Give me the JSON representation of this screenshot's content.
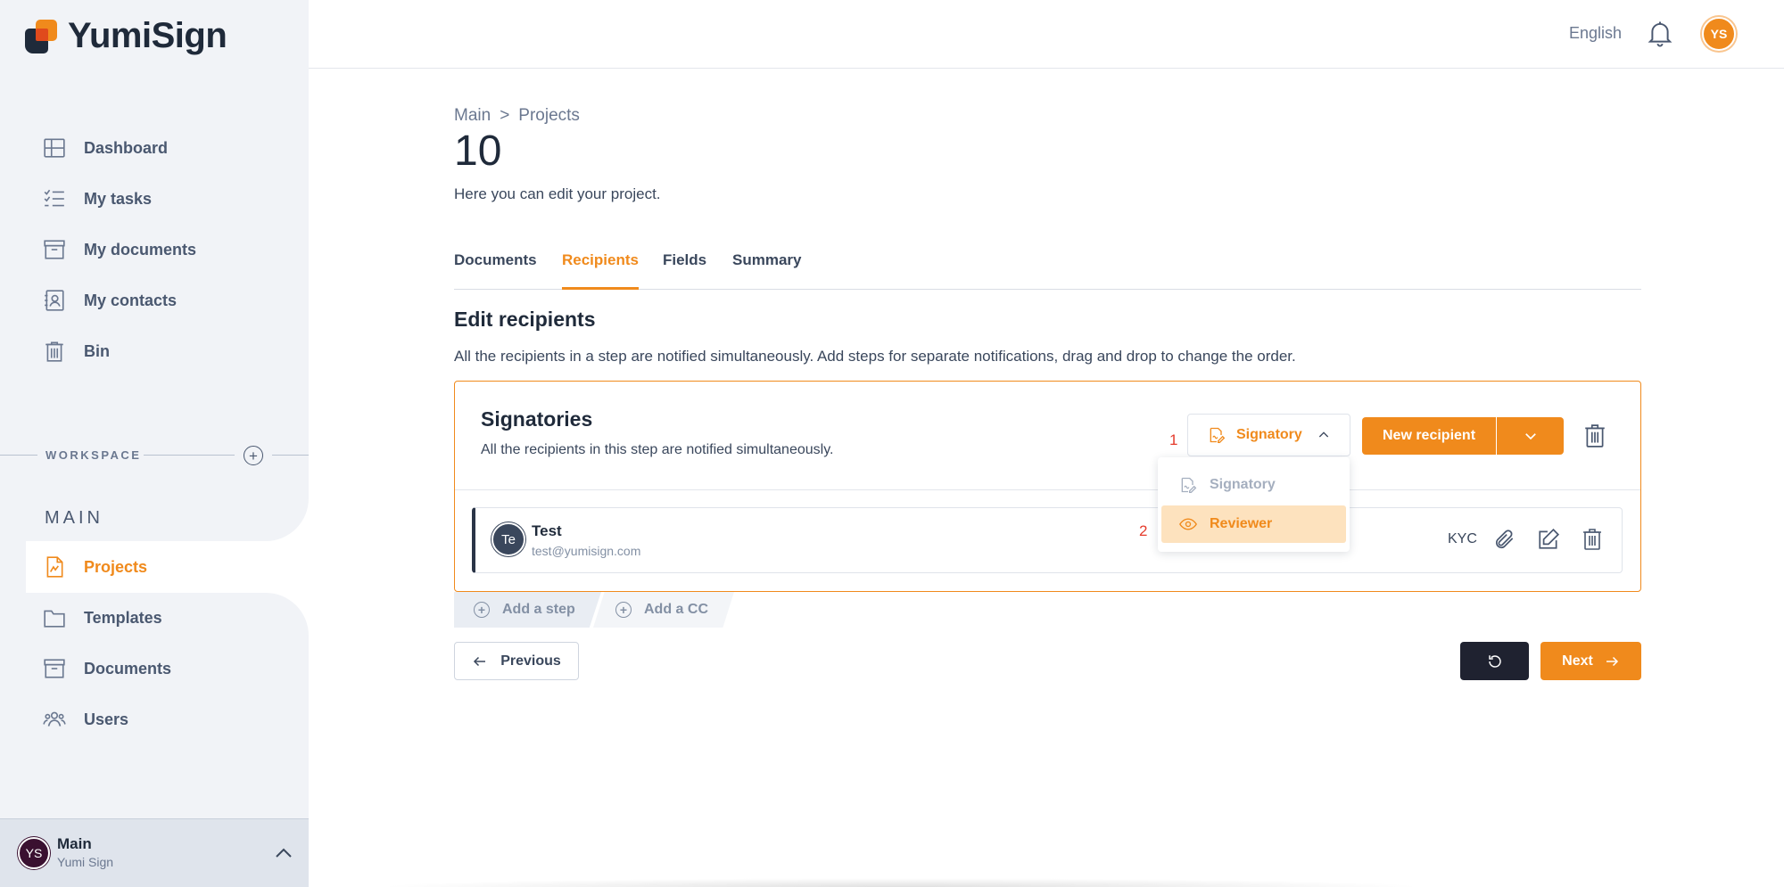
{
  "app": {
    "name": "YumiSign"
  },
  "sidebar": {
    "nav": [
      {
        "label": "Dashboard",
        "icon": "dashboard-icon"
      },
      {
        "label": "My tasks",
        "icon": "tasks-icon"
      },
      {
        "label": "My documents",
        "icon": "archive-icon"
      },
      {
        "label": "My contacts",
        "icon": "contacts-icon"
      },
      {
        "label": "Bin",
        "icon": "trash-icon"
      }
    ],
    "workspace_label": "WORKSPACE",
    "workspace_name": "MAIN",
    "workspace_items": [
      {
        "label": "Projects",
        "icon": "projects-icon",
        "active": true
      },
      {
        "label": "Templates",
        "icon": "folder-icon"
      },
      {
        "label": "Documents",
        "icon": "archive-icon"
      },
      {
        "label": "Users",
        "icon": "users-icon"
      }
    ],
    "account": {
      "initials": "YS",
      "name": "Main",
      "sub": "Yumi Sign"
    }
  },
  "topbar": {
    "language": "English",
    "avatar_initials": "YS"
  },
  "breadcrumb": {
    "root": "Main",
    "separator": ">",
    "current": "Projects"
  },
  "page": {
    "title": "10",
    "subtitle": "Here you can edit your project."
  },
  "tabs": [
    {
      "label": "Documents"
    },
    {
      "label": "Recipients",
      "active": true
    },
    {
      "label": "Fields"
    },
    {
      "label": "Summary"
    }
  ],
  "section": {
    "title": "Edit recipients",
    "description": "All the recipients in a step are notified simultaneously. Add steps for separate notifications, drag and drop to change the order."
  },
  "step": {
    "title": "Signatories",
    "description": "All the recipients in this step are notified simultaneously.",
    "role_selected": "Signatory",
    "new_recipient_label": "New recipient",
    "annotation_1": "1",
    "annotation_2": "2",
    "role_options": [
      {
        "label": "Signatory",
        "disabled": true
      },
      {
        "label": "Reviewer",
        "highlighted": true
      }
    ],
    "recipient": {
      "initials": "Te",
      "name": "Test",
      "email": "test@yumisign.com",
      "kyc_label": "KYC"
    }
  },
  "actions": {
    "add_step": "Add a step",
    "add_cc": "Add a CC",
    "previous": "Previous",
    "next": "Next"
  },
  "colors": {
    "accent": "#f08a1c",
    "dark": "#1f2230",
    "sidebar_bg": "#f1f3f7",
    "annotation": "#e53b2c"
  }
}
